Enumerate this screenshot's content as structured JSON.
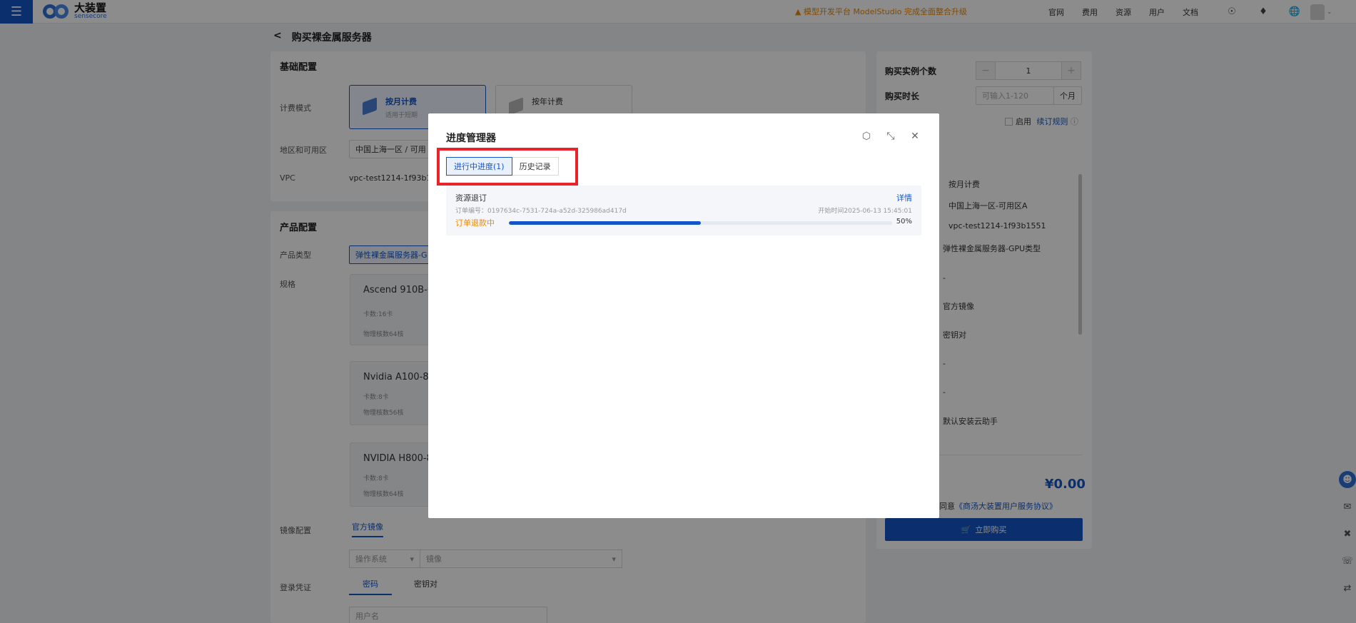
{
  "topbar": {
    "brand_cn": "大装置",
    "brand_en": "sensecore",
    "notice": "模型开发平台 ModelStudio 完成全面整合升级",
    "nav": [
      "官网",
      "费用",
      "资源",
      "用户",
      "文档"
    ]
  },
  "page": {
    "back": "<",
    "title": "购买裸金属服务器"
  },
  "basic": {
    "title": "基础配置",
    "billing_label": "计费模式",
    "monthly_title": "按月计费",
    "monthly_desc": "适用于短期",
    "yearly_title": "按年计费",
    "region_label": "地区和可用区",
    "region_value": "中国上海一区 / 可用",
    "vpc_label": "VPC",
    "vpc_value": "vpc-test1214-1f93b15"
  },
  "product": {
    "title": "产品配置",
    "type_label": "产品类型",
    "type_value": "弹性裸金属服务器-G",
    "spec_label": "规格",
    "specs": [
      {
        "name": "Ascend 910B-64",
        "cards": "卡数:16卡",
        "cores": "物理核数64核"
      },
      {
        "name": "Nvidia A100-80G",
        "cards": "卡数:8卡",
        "cores": "物理核数56核"
      },
      {
        "name": "NVIDIA H800-80",
        "cards": "卡数:8卡",
        "cores": "物理核数64核"
      }
    ],
    "image_label": "镜像配置",
    "image_tab": "官方镜像",
    "os_placeholder": "操作系统",
    "image_placeholder": "镜像",
    "login_label": "登录凭证",
    "login_tab_password": "密码",
    "login_tab_keypair": "密钥对",
    "username_placeholder": "用户名"
  },
  "summary": {
    "qty_label": "购买实例个数",
    "qty_value": "1",
    "duration_label": "购买时长",
    "duration_placeholder": "可输入1-120",
    "duration_unit": "个月",
    "auto_renew": "启用",
    "renew_rule": "续订规则",
    "items": [
      "按月计费",
      "中国上海一区-可用区A",
      "vpc-test1214-1f93b1551",
      "弹性裸金属服务器-GPU类型",
      "-",
      "官方镜像",
      "密钥对",
      "-",
      "-",
      "默认安装云助手"
    ],
    "price": "¥0.00",
    "agree_prefix": "同意",
    "agreement": "《商汤大装置用户服务协议》",
    "buy": "立即购买"
  },
  "modal": {
    "title": "进度管理器",
    "tabs": [
      "进行中进度(1)",
      "历史记录"
    ],
    "task": {
      "name": "资源退订",
      "detail": "详情",
      "order": "订单编号：0197634c-7531-724a-a52d-325986ad417d",
      "time": "开始时间2025-06-13 15:45:01",
      "status": "订单退款中",
      "progress": 0.5,
      "percent": "50%"
    }
  },
  "colors": {
    "accent": "#1456c7",
    "warning": "#e8890c",
    "highlight": "#e8232a"
  }
}
